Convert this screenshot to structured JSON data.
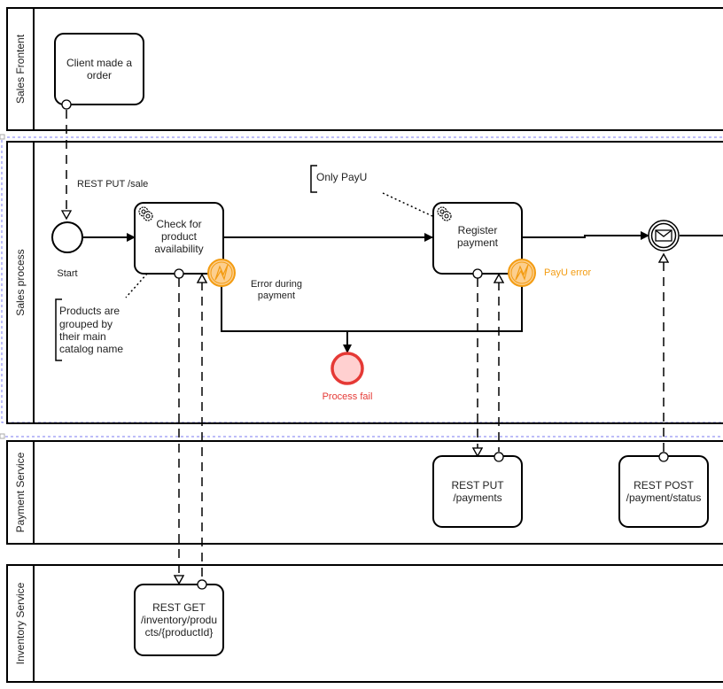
{
  "colors": {
    "stroke": "#000000",
    "error_orange": "#f39c12",
    "error_fill": "#fccf8f",
    "fail_red": "#e53935",
    "fail_fill": "#ffd0d0",
    "selection_dash": "#7b7bf2"
  },
  "lanes": [
    {
      "id": "sales-frontend",
      "label": "Sales Frontent"
    },
    {
      "id": "sales-process",
      "label": "Sales process"
    },
    {
      "id": "payment-service",
      "label": "Payment Service"
    },
    {
      "id": "inventory-service",
      "label": "Inventory Service"
    }
  ],
  "tasks": {
    "client_order": {
      "lines": [
        "Client made a",
        "order"
      ]
    },
    "check_availability": {
      "lines": [
        "Check for",
        "product",
        "availability"
      ],
      "icon": "gear-icon"
    },
    "register_payment": {
      "lines": [
        "Register",
        "payment"
      ],
      "icon": "gear-icon"
    },
    "rest_put_payments": {
      "lines": [
        "REST PUT",
        "/payments"
      ]
    },
    "rest_post_status": {
      "lines": [
        "REST POST",
        "/payment/status"
      ]
    },
    "rest_get_inventory": {
      "lines": [
        "REST GET",
        "/inventory/produ",
        "cts/{productId}"
      ]
    }
  },
  "events": {
    "start": {
      "label": "Start"
    },
    "process_fail": {
      "label": "Process fail"
    },
    "message_catch": {
      "icon": "envelope-icon"
    }
  },
  "boundary_events": {
    "check_error": {
      "icon": "error-bolt-icon",
      "label_lines": [
        "Error during",
        "payment"
      ]
    },
    "payu_error": {
      "icon": "error-bolt-icon",
      "label": "PayU error"
    }
  },
  "flow_labels": {
    "rest_put_sale": "REST PUT /sale"
  },
  "annotations": {
    "products_grouped": {
      "lines": [
        "Products are",
        "grouped by",
        "their main",
        "catalog name"
      ]
    },
    "only_payu": {
      "lines": [
        "Only PayU"
      ]
    }
  }
}
